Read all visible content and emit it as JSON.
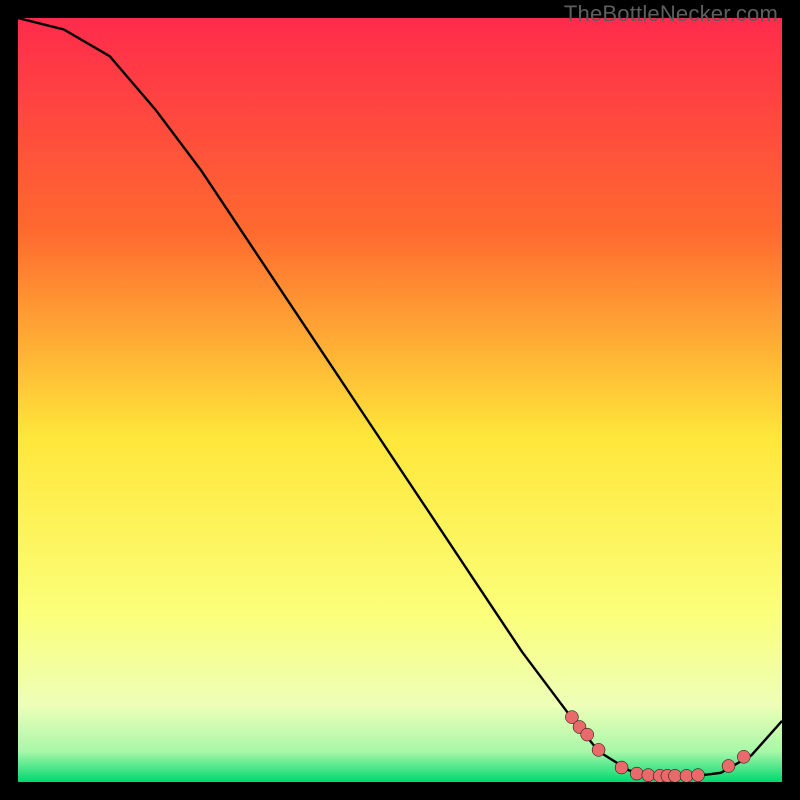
{
  "watermark": "TheBottleNecker.com",
  "colors": {
    "top": "#ff2b4c",
    "mid_upper": "#ff8a2a",
    "mid": "#ffe73a",
    "mid_lower": "#f7ff8a",
    "near_bottom": "#d7ffb0",
    "bottom": "#00d870",
    "curve": "#000000",
    "marker": "#e86a6a",
    "marker_stroke": "#000000"
  },
  "chart_data": {
    "type": "line",
    "title": "",
    "xlabel": "",
    "ylabel": "",
    "xlim": [
      0,
      100
    ],
    "ylim": [
      0,
      100
    ],
    "series": [
      {
        "name": "bottleneck-curve",
        "x": [
          0,
          6,
          12,
          18,
          24,
          30,
          36,
          42,
          48,
          54,
          60,
          66,
          72,
          76,
          80,
          84,
          88,
          92,
          96,
          100
        ],
        "y": [
          100,
          98.5,
          95,
          88,
          80,
          71,
          62,
          53,
          44,
          35,
          26,
          17,
          9,
          4,
          1.5,
          0.8,
          0.7,
          1.2,
          3.5,
          8
        ]
      }
    ],
    "markers": {
      "name": "highlight-points",
      "x": [
        72.5,
        73.5,
        74.5,
        76,
        79,
        81,
        82.5,
        84,
        85,
        86,
        87.5,
        89,
        93,
        95
      ],
      "y": [
        8.5,
        7.2,
        6.2,
        4.2,
        1.9,
        1.1,
        0.9,
        0.8,
        0.8,
        0.8,
        0.8,
        0.9,
        2.1,
        3.3
      ]
    }
  }
}
